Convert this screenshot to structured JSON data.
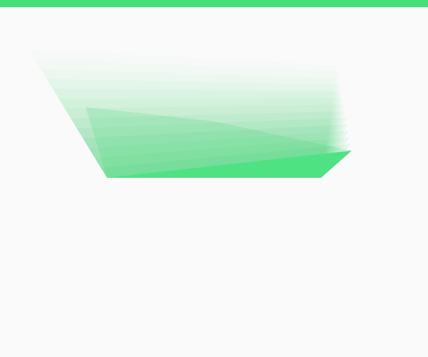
{
  "colors": {
    "background": "#fafafa",
    "accent": "#44df78",
    "fan_fill": "#34d46a",
    "base_fill": "#4ee283"
  },
  "scene": {
    "description_items": [],
    "fan_layers": 14
  }
}
